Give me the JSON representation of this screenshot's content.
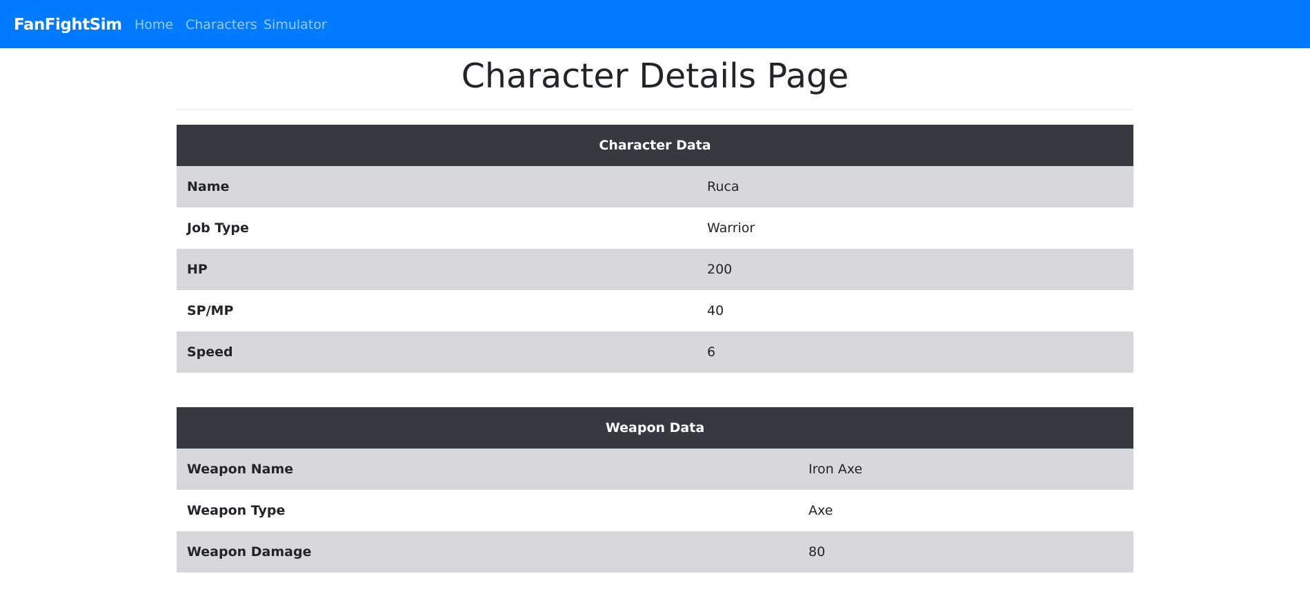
{
  "navbar": {
    "brand": "FanFightSim",
    "links": [
      {
        "label": "Home"
      },
      {
        "label": "Characters"
      },
      {
        "label": "Simulator"
      }
    ],
    "color": "#007bff"
  },
  "page_title": "Character Details Page",
  "character_table": {
    "header": "Character Data",
    "rows": [
      {
        "key": "Name",
        "value": "Ruca"
      },
      {
        "key": "Job Type",
        "value": "Warrior"
      },
      {
        "key": "HP",
        "value": "200"
      },
      {
        "key": "SP/MP",
        "value": "40"
      },
      {
        "key": "Speed",
        "value": "6"
      }
    ]
  },
  "weapon_table": {
    "header": "Weapon Data",
    "rows": [
      {
        "key": "Weapon Name",
        "value": "Iron Axe"
      },
      {
        "key": "Weapon Type",
        "value": "Axe"
      },
      {
        "key": "Weapon Damage",
        "value": "80"
      }
    ]
  },
  "colors": {
    "header_bg": "#343a40",
    "striped_row": "#d6d8db"
  }
}
